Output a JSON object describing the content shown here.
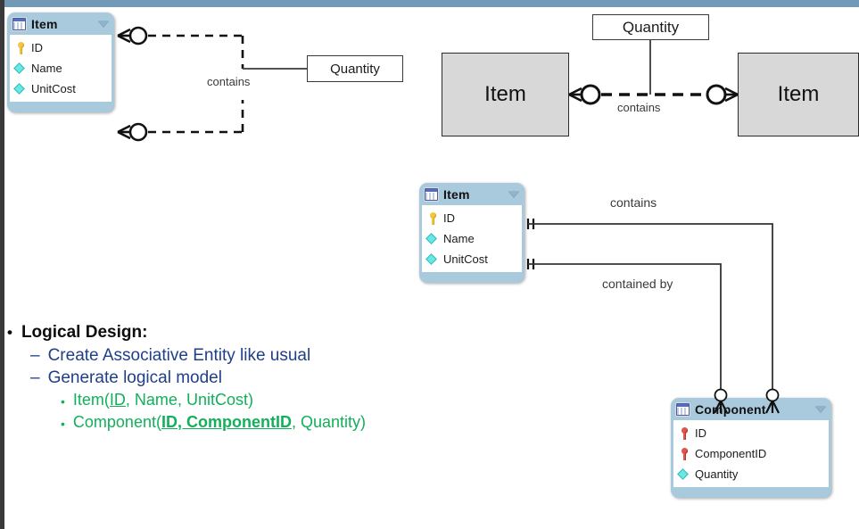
{
  "slide": {
    "title": "Logical Design",
    "accent_header_color": "#7299b5",
    "entity_header_color": "#a9c9dd"
  },
  "conceptual_left": {
    "entity": {
      "name": "Item",
      "attributes": [
        {
          "label": "ID",
          "icon": "primary-key-icon"
        },
        {
          "label": "Name",
          "icon": "attribute-diamond-icon"
        },
        {
          "label": "UnitCost",
          "icon": "attribute-diamond-icon"
        }
      ]
    },
    "relationship_label": "contains",
    "attribute_box": "Quantity"
  },
  "conceptual_middle": {
    "left_entity": "Item",
    "right_entity": "Item",
    "relationship_label": "contains",
    "attribute_box": "Quantity"
  },
  "logical": {
    "item_entity": {
      "name": "Item",
      "attributes": [
        {
          "label": "ID",
          "icon": "primary-key-icon"
        },
        {
          "label": "Name",
          "icon": "attribute-diamond-icon"
        },
        {
          "label": "UnitCost",
          "icon": "attribute-diamond-icon"
        }
      ]
    },
    "component_entity": {
      "name": "Component",
      "attributes": [
        {
          "label": "ID",
          "icon": "foreign-key-icon"
        },
        {
          "label": "ComponentID",
          "icon": "foreign-key-icon"
        },
        {
          "label": "Quantity",
          "icon": "attribute-diamond-icon"
        }
      ]
    },
    "relationship_top": "contains",
    "relationship_bottom": "contained by"
  },
  "bullets": {
    "level1": "Logical Design:",
    "level2": [
      "Create Associative Entity like usual",
      "Generate logical model"
    ],
    "level3": [
      {
        "prefix": "Item(",
        "key": "ID",
        "rest": ", Name, UnitCost)",
        "key_style": "underline"
      },
      {
        "prefix": "Component(",
        "key": "ID, ComponentID",
        "rest": ", Quantity)",
        "key_style": "bold-underline"
      }
    ],
    "marker_level1": "•",
    "marker_level2": "–",
    "marker_level3": "•"
  }
}
